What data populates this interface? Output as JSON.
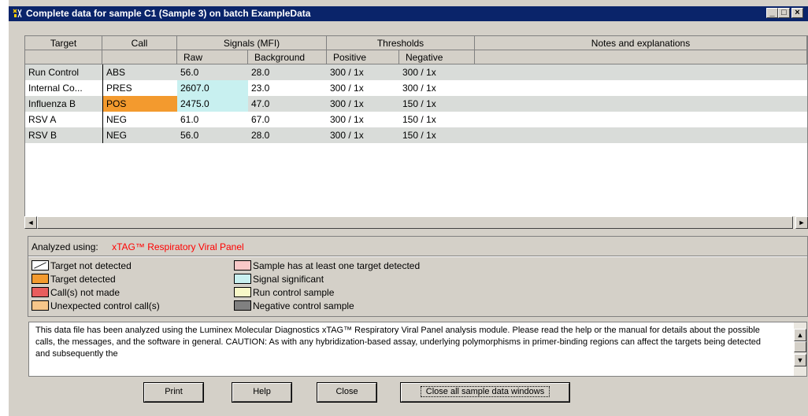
{
  "window": {
    "title": "Complete data for sample C1 (Sample 3) on batch ExampleData",
    "minimize_glyph": "_",
    "maximize_glyph": "□",
    "close_glyph": "×"
  },
  "table": {
    "headers": {
      "target": "Target",
      "call": "Call",
      "signals": "Signals (MFI)",
      "thresholds": "Thresholds",
      "notes": "Notes and explanations",
      "raw": "Raw",
      "background": "Background",
      "positive": "Positive",
      "negative": "Negative"
    },
    "rows": [
      {
        "target": "Run Control",
        "call": "ABS",
        "raw": "56.0",
        "background": "28.0",
        "positive": "300 / 1x",
        "negative": "300 / 1x",
        "notes": ""
      },
      {
        "target": "Internal Co...",
        "call": "PRES",
        "raw": "2607.0",
        "background": "23.0",
        "positive": "300 / 1x",
        "negative": "300 / 1x",
        "notes": ""
      },
      {
        "target": "Influenza B",
        "call": "POS",
        "raw": "2475.0",
        "background": "47.0",
        "positive": "300 / 1x",
        "negative": "150 / 1x",
        "notes": ""
      },
      {
        "target": "RSV A",
        "call": "NEG",
        "raw": "61.0",
        "background": "67.0",
        "positive": "300 / 1x",
        "negative": "150 / 1x",
        "notes": ""
      },
      {
        "target": "RSV B",
        "call": "NEG",
        "raw": "56.0",
        "background": "28.0",
        "positive": "300 / 1x",
        "negative": "150 / 1x",
        "notes": ""
      }
    ]
  },
  "scrollbar": {
    "left_arrow": "◄",
    "right_arrow": "►",
    "up_arrow": "▲",
    "down_arrow": "▼"
  },
  "legend": {
    "analyzed_label": "Analyzed using:",
    "panel_name": "xTAG™ Respiratory Viral Panel",
    "items_left": [
      {
        "label": "Target not detected",
        "color": "#ffffff"
      },
      {
        "label": "Target detected",
        "color": "#f39a2e"
      },
      {
        "label": "Call(s) not made",
        "color": "#e85d5d"
      },
      {
        "label": "Unexpected control call(s)",
        "color": "#f7c68a"
      }
    ],
    "items_right": [
      {
        "label": "Sample has at least one target detected",
        "color": "#f8c8c8"
      },
      {
        "label": "Signal significant",
        "color": "#c8f0f0"
      },
      {
        "label": "Run control sample",
        "color": "#f8f8c8"
      },
      {
        "label": "Negative control sample",
        "color": "#808080"
      }
    ]
  },
  "message": {
    "text": "This data file has been analyzed using the Luminex Molecular Diagnostics xTAG™ Respiratory Viral Panel analysis module. Please read the help or the manual for details about the possible calls, the messages, and the software in general. CAUTION:  As with any hybridization-based assay, underlying polymorphisms in primer-binding regions can affect the targets being detected and subsequently the"
  },
  "buttons": {
    "print": "Print",
    "help": "Help",
    "close": "Close",
    "close_all": "Close all sample data windows"
  },
  "colors": {
    "title_bar": "#0a246a",
    "signal_significant": "#c8f0f0",
    "target_detected": "#f39a2e",
    "row_stripe": "#d9dcd9",
    "analyzed_panel_text": "#ff0000"
  }
}
